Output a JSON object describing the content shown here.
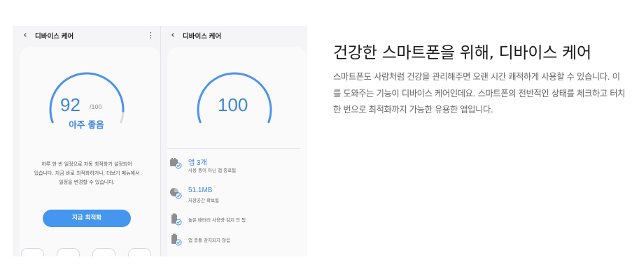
{
  "screen_left": {
    "header_title": "디바이스 케어",
    "score": "92",
    "score_max": "/100",
    "status": "아주 좋음",
    "description": "하루 한 번 일정으로 자동 최적화가 설정되어\n있습니다. 지금 바로 최적화하거나, 더보기 메뉴에서\n일정을 변경할 수 있습니다.",
    "optimize_button": "지금 최적화",
    "gauge_fraction": 0.92
  },
  "screen_right": {
    "header_title": "디바이스 케어",
    "score": "100",
    "gauge_fraction": 1.0,
    "items": [
      {
        "title": "앱 3개",
        "subtitle": "사용 중이 아닌 앱 종료됨",
        "icon": "apps-check-icon"
      },
      {
        "title": "51.1MB",
        "subtitle": "저장공간 확보됨",
        "icon": "storage-check-icon"
      },
      {
        "title": "",
        "subtitle": "높은 배터리 사용량 감지 안 됨",
        "icon": "battery-check-icon"
      },
      {
        "title": "",
        "subtitle": "앱 충돌 감지되지 않음",
        "icon": "app-crash-check-icon"
      }
    ]
  },
  "headline": "건강한 스마트폰을 위해, 디바이스 케어",
  "body": "스마트폰도 사람처럼 건강을 관리해주면 오랜 시간 쾌적하게 사용할 수 있습니다. 이를 도와주는 기능이 디바이스 케어인데요. 스마트폰의 전반적인 상태를 체크하고 터치 한 번으로 최적화까지 가능한 유용한 앱입니다.",
  "colors": {
    "accent": "#3c85e0",
    "button": "#4596ee",
    "panel_bg": "#f5f5f7"
  }
}
